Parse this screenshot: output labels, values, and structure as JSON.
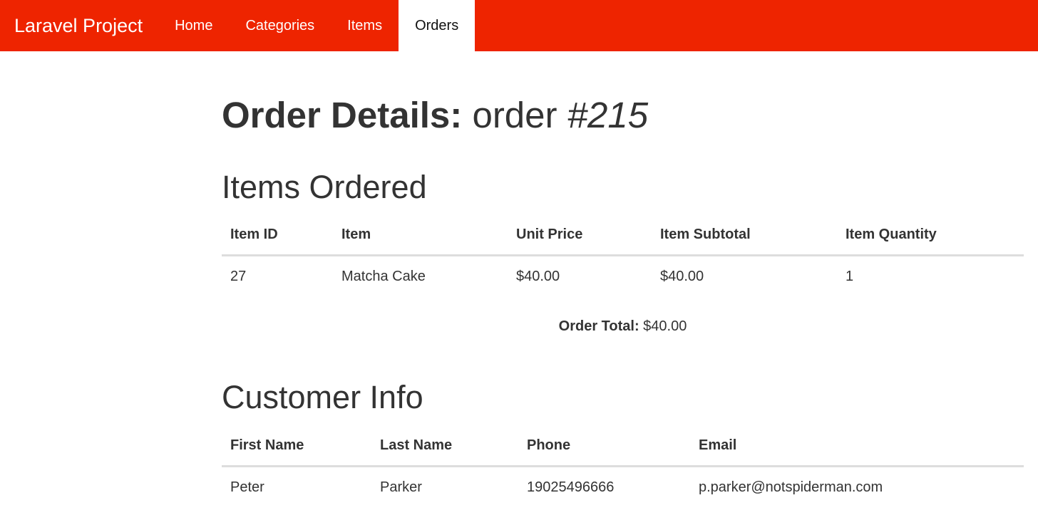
{
  "nav": {
    "brand": "Laravel Project",
    "items": [
      {
        "label": "Home"
      },
      {
        "label": "Categories"
      },
      {
        "label": "Items"
      },
      {
        "label": "Orders",
        "active": true
      }
    ]
  },
  "page": {
    "title_bold": "Order Details:",
    "title_normal": "order",
    "title_italic": "#215"
  },
  "items_section": {
    "title": "Items Ordered",
    "columns": [
      "Item ID",
      "Item",
      "Unit Price",
      "Item Subtotal",
      "Item Quantity"
    ],
    "rows": [
      [
        "27",
        "Matcha Cake",
        "$40.00",
        "$40.00",
        "1"
      ]
    ]
  },
  "order_total": {
    "label": "Order Total:",
    "value": "$40.00"
  },
  "customer_section": {
    "title": "Customer Info",
    "columns": [
      "First Name",
      "Last Name",
      "Phone",
      "Email"
    ],
    "rows": [
      [
        "Peter",
        "Parker",
        "19025496666",
        "p.parker@notspiderman.com"
      ]
    ]
  },
  "colors": {
    "navbar": "#ee2400",
    "text": "#333333"
  }
}
